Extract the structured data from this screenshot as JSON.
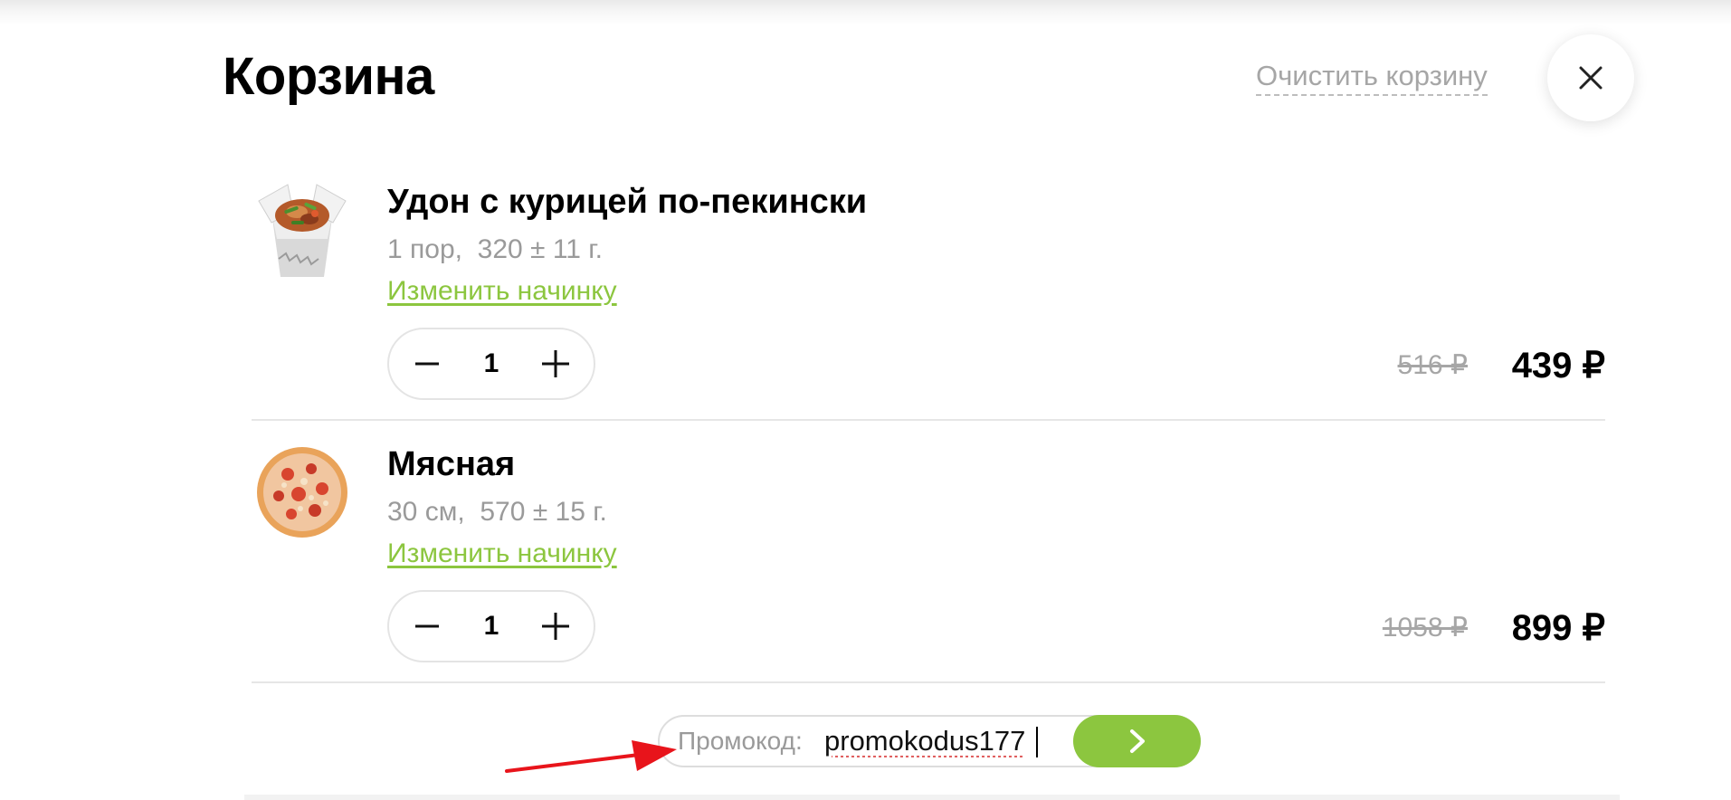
{
  "cart": {
    "title": "Корзина",
    "clear_label": "Очистить корзину",
    "close_icon": "close-icon"
  },
  "items": [
    {
      "name": "Удон с курицей по-пекински",
      "meta": "1 пор,  320 ± 11 г.",
      "change_label": "Изменить начинку",
      "quantity": "1",
      "old_price": "516 ₽",
      "price": "439  ₽",
      "image_icon": "udon-box-image"
    },
    {
      "name": "Мясная",
      "meta": "30 см,  570 ± 15 г.",
      "change_label": "Изменить начинку",
      "quantity": "1",
      "old_price": "1058 ₽",
      "price": "899  ₽",
      "image_icon": "pizza-image"
    }
  ],
  "promo": {
    "label": "Промокод:",
    "value": "promokodus177",
    "submit_icon": "chevron-right-icon"
  },
  "colors": {
    "accent_green": "#8cc63f",
    "muted_text": "#9a9a9a",
    "annotation_arrow": "#e8141b"
  }
}
